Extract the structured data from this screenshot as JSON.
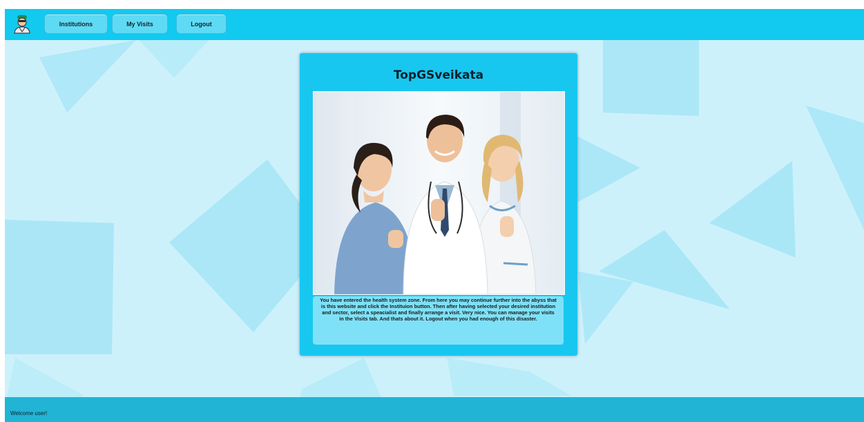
{
  "navbar": {
    "logo_icon": "doctor-avatar-icon",
    "items": [
      {
        "label": "Institutions"
      },
      {
        "label": "My Visits"
      },
      {
        "label": "Logout"
      }
    ]
  },
  "card": {
    "title": "TopGSveikata",
    "image": "three-smiling-medical-workers-thumbs-up-photo",
    "description": "You have entered the health system zone. From here you may continue further into the abyss that is this website and click the Instituion button. Then after having selected your desired institution and sector, select a speacialist and finally arrange a visit. Very nice. You can manage your visits in the Visits tab. And thats about it. Logout when you had enough of this disaster."
  },
  "footer": {
    "text": "Welcome user!"
  },
  "colors": {
    "navbar": "#12c9ef",
    "background": "#cdf1fb",
    "card": "#18c7ef",
    "description_box": "#7ee1f8",
    "footer": "#21b4d4"
  }
}
